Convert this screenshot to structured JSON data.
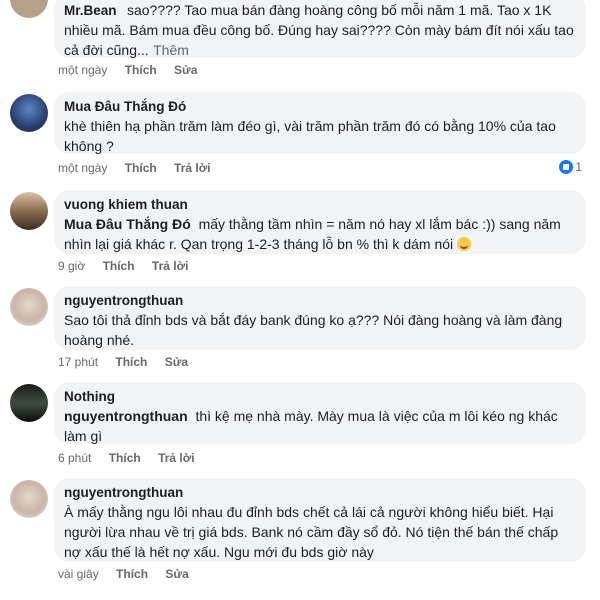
{
  "comments": [
    {
      "author": "Mr.Bean",
      "text": "sao???? Tao mua bán đàng hoàng công bố mỗi năm 1 mã. Tao x 1K nhiều mã. Bám mua đều công bố. Đúng hay sai???? Còn mày bám đít nói xấu tao cả đời cũng...",
      "more": "Thêm",
      "time": "một ngày",
      "like": "Thích",
      "action2": "Sửa"
    },
    {
      "author": "Mua Đâu Thắng Đó",
      "text": "khè thiên hạ phần trăm làm đéo gì, vài trăm phần trăm đó có bằng 10% của tao không ?",
      "time": "một ngày",
      "like": "Thích",
      "action2": "Trả lời",
      "reactions": "1"
    },
    {
      "author": "vuong khiem thuan",
      "mention": "Mua Đâu Thắng Đó",
      "text": "mấy thằng tầm nhìn = năm nó hay xl lắm bác :)) sang năm nhìn lại giá khác r. Qan trọng 1-2-3 tháng lỗ bn % thì k dám nói",
      "emoji": "grinning-sweat-emoji",
      "time": "9 giờ",
      "like": "Thích",
      "action2": "Trả lời"
    },
    {
      "author": "nguyentrongthuan",
      "text": "Sao tôi thả đỉnh bds và bắt đáy bank đúng ko ạ??? Nói đàng hoàng và làm đàng hoàng nhé.",
      "time": "17 phút",
      "like": "Thích",
      "action2": "Sửa"
    },
    {
      "author": "Nothing",
      "mention": "nguyentrongthuan",
      "text": "thì kệ mẹ nhà mày. Mày mua là việc của m lôi kéo ng khác làm gì",
      "time": "6 phút",
      "like": "Thích",
      "action2": "Trả lời"
    },
    {
      "author": "nguyentrongthuan",
      "text": "À mấy thằng ngu lôi nhau đu đỉnh bds chết cả lái cả người không hiểu biết. Hại người lừa nhau về trị giá bds. Bank nó cầm đầy sổ đỏ. Nó tiện thế bán thế chấp nợ xấu thế là hết nợ xấu. Ngu mới đu bds giờ này",
      "time": "vài giây",
      "like": "Thích",
      "action2": "Sửa"
    }
  ],
  "colors": {
    "bubble": "#f2f3f5",
    "meta": "#65676b",
    "like_badge": "#1877f2"
  }
}
